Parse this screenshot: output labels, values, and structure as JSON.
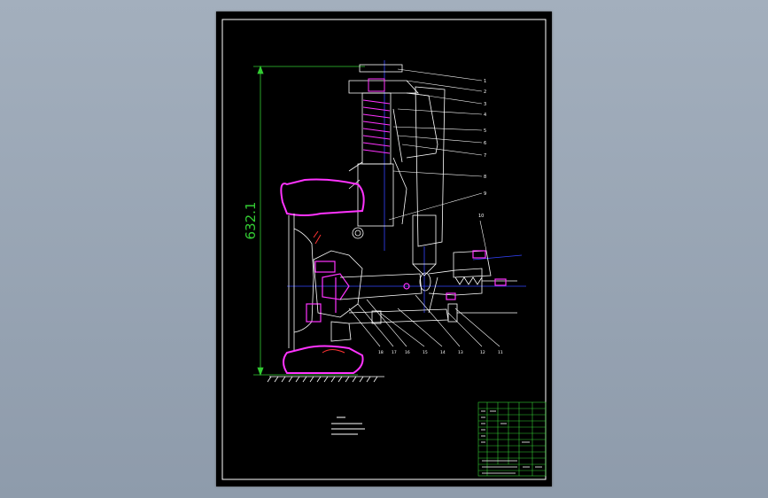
{
  "drawing": {
    "dimension_label": "632.1",
    "balloons_right": [
      "1",
      "2",
      "3",
      "4",
      "5",
      "6",
      "7",
      "8",
      "9"
    ],
    "balloons_bottom": [
      "18",
      "17",
      "16",
      "15",
      "14",
      "13",
      "12",
      "11"
    ],
    "balloon_top_right": "10"
  },
  "colors": {
    "sheet": "#000000",
    "border": "#ffffff",
    "outline": "#ffffff",
    "highlight": "#ff33ff",
    "dimension": "#33cc33",
    "axis": "#3344ff",
    "title_block": "#33cc33",
    "note": "#ffffff",
    "accent_red": "#ff3333"
  }
}
